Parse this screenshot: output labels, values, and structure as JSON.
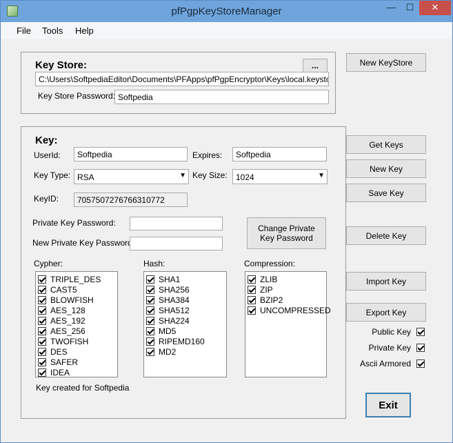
{
  "window": {
    "title": "pfPgpKeyStoreManager",
    "min": "—",
    "max": "☐",
    "close": "✕"
  },
  "menu": [
    "File",
    "Tools",
    "Help"
  ],
  "keystore": {
    "title": "Key Store:",
    "browse_label": "...",
    "path": "C:\\Users\\SoftpediaEditor\\Documents\\PFApps\\pfPgpEncryptor\\Keys\\local.keystore",
    "password_label": "Key Store Password:",
    "password": "Softpedia"
  },
  "key": {
    "title": "Key:",
    "userid_label": "UserId:",
    "userid": "Softpedia",
    "expires_label": "Expires:",
    "expires": "Softpedia",
    "keytype_label": "Key Type:",
    "keytype": "RSA",
    "keysize_label": "Key Size:",
    "keysize": "1024",
    "keyid_label": "KeyID:",
    "keyid": "7057507276766310772",
    "private_pw_label": "Private Key Password:",
    "new_private_pw_label": "New Private Key Password:",
    "change_pw_button": "Change Private Key Password",
    "cypher_label": "Cypher:",
    "hash_label": "Hash:",
    "compression_label": "Compression:",
    "cyphers": [
      "TRIPLE_DES",
      "CAST5",
      "BLOWFISH",
      "AES_128",
      "AES_192",
      "AES_256",
      "TWOFISH",
      "DES",
      "SAFER",
      "IDEA"
    ],
    "hashes": [
      "SHA1",
      "SHA256",
      "SHA384",
      "SHA512",
      "SHA224",
      "MD5",
      "RIPEMD160",
      "MD2"
    ],
    "compressions": [
      "ZLIB",
      "ZIP",
      "BZIP2",
      "UNCOMPRESSED"
    ],
    "status": "Key created for Softpedia"
  },
  "buttons": {
    "new_keystore": "New KeyStore",
    "get_keys": "Get Keys",
    "new_key": "New Key",
    "save_key": "Save Key",
    "delete_key": "Delete Key",
    "import_key": "Import Key",
    "export_key": "Export Key",
    "exit": "Exit"
  },
  "export_options": {
    "public_key": "Public Key",
    "private_key": "Private Key",
    "ascii_armored": "Ascii Armored"
  }
}
